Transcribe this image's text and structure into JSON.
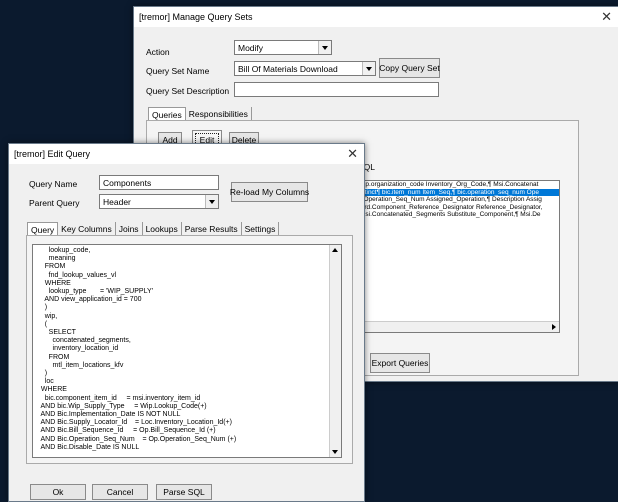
{
  "manage": {
    "title": "[tremor] Manage Query Sets",
    "action_label": "Action",
    "action_value": "Modify",
    "query_set_name_label": "Query Set Name",
    "query_set_name_value": "Bill Of Materials Download",
    "copy_button": "Copy Query Set",
    "query_set_desc_label": "Query Set Description",
    "query_set_desc_value": "",
    "tabs": [
      "Queries",
      "Responsibilities"
    ],
    "add_button": "Add",
    "edit_button": "Edit",
    "delete_button": "Delete",
    "sql_label": "SQL",
    "sql_rows": [
      "mp.organization_code Inventory_Org_Code,¶ Msi.Concatenat",
      "istinct¶ bic.item_num Item_Seq,¶ bic.operation_seq_num Ope",
      "| Operation_Seq_Num Assigned_Operation,¶ Description Assig",
      "Brd.Component_Reference_Designator Reference_Designator,",
      "Msi.Concatenated_Segments Substitute_Component,¶ Msi.De"
    ],
    "selected_sql_row": 1,
    "export_button": "Export Queries"
  },
  "edit": {
    "title": "[tremor] Edit Query",
    "query_name_label": "Query Name",
    "query_name_value": "Components",
    "parent_query_label": "Parent Query",
    "parent_query_value": "Header",
    "reload_button": "Re-load My Columns",
    "tabs": [
      "Query",
      "Key Columns",
      "Joins",
      "Lookups",
      "Parse Results",
      "Settings"
    ],
    "code": "      lookup_code,\n      meaning\n    FROM\n      fnd_lookup_values_vl\n    WHERE\n      lookup_type       = 'WIP_SUPPLY'\n    AND view_application_id = 700\n    )\n    wip,\n    (\n      SELECT\n        concatenated_segments,\n        inventory_location_id\n      FROM\n        mtl_item_locations_kfv\n    )\n    loc\n  WHERE\n    bic.component_item_id     = msi.inventory_item_id\n  AND bic.Wip_Supply_Type     = Wip.Lookup_Code(+)\n  AND Bic.Implementation_Date IS NOT NULL\n  AND Bic.Supply_Locator_Id    = Loc.Inventory_Location_Id(+)\n  AND Bic.Bill_Sequence_Id     = Op.Bill_Sequence_Id (+)\n  AND Bic.Operation_Seq_Num    = Op.Operation_Seq_Num (+)\n  AND Bic.Disable_Date IS NULL",
    "ok_button": "Ok",
    "cancel_button": "Cancel",
    "parse_button": "Parse SQL"
  },
  "colors": {
    "background": "#0b1a2e",
    "selection": "#0078d7",
    "dialog": "#f0f0f0"
  }
}
